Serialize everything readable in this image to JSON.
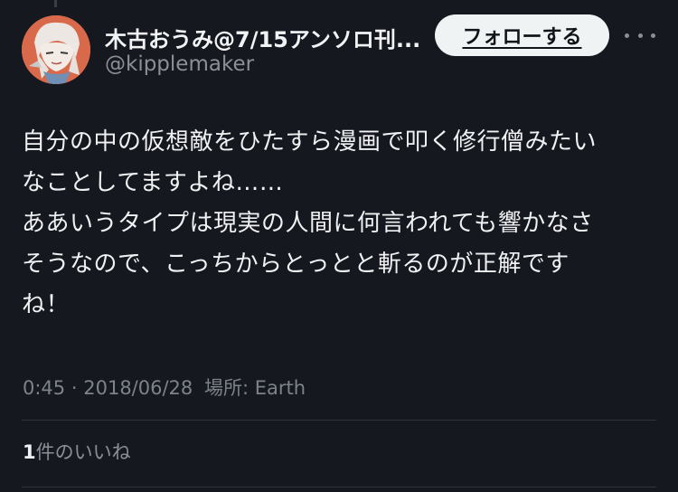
{
  "author": {
    "display_name": "木古おうみ@7/15アンソロ刊...",
    "handle": "@kipplemaker"
  },
  "follow_label": "フォローする",
  "more_icon": "more-horizontal-icon",
  "tweet": {
    "lines": [
      "自分の中の仮想敵をひたすら漫画で叩く修行僧みたい",
      "なことしてますよね……",
      "ああいうタイプは現実の人間に何言われても響かなさ",
      "そうなので、こっちからとっとと斬るのが正解です",
      "ね！"
    ]
  },
  "meta": {
    "time": "0:45",
    "separator": "·",
    "date": "2018/06/28",
    "location_label": "場所:",
    "location": "Earth"
  },
  "likes": {
    "count": "1",
    "label": "件のいいね"
  },
  "colors": {
    "background": "#15181f",
    "text_primary": "#f0f1f2",
    "text_secondary": "#8b9096",
    "follow_button_bg": "#eff3f4",
    "divider": "#2f343b"
  }
}
